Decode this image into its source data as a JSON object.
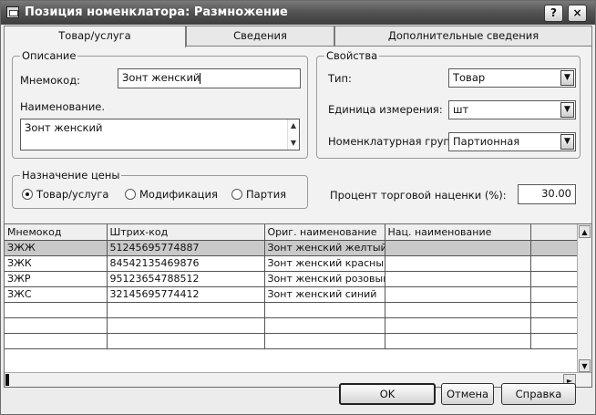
{
  "window": {
    "title": "Позиция номенклатора: Размножение"
  },
  "tabs": [
    "Товар/услуга",
    "Сведения",
    "Дополнительные сведения"
  ],
  "description": {
    "group_label": "Описание",
    "mnemocode_label": "Мнемокод:",
    "mnemocode_value": "Зонт женский",
    "name_label": "Наименование.",
    "name_value": "Зонт женский"
  },
  "price_purpose": {
    "group_label": "Назначение цены",
    "options": [
      "Товар/услуга",
      "Модификация",
      "Партия"
    ],
    "selected": "Товар/услуга"
  },
  "properties": {
    "group_label": "Свойства",
    "type_label": "Тип:",
    "type_value": "Товар",
    "unit_label": "Единица измерения:",
    "unit_value": "шт",
    "group_field_label": "Номенклатурная группа:",
    "group_field_value": "Партионная"
  },
  "markup": {
    "label": "Процент торговой наценки (%):",
    "value": "30.00"
  },
  "grid": {
    "columns": [
      "Мнемокод",
      "Штрих-код",
      "Ориг. наименование",
      "Нац. наименование"
    ],
    "rows": [
      [
        "ЗЖЖ",
        "5124569577488​7",
        "Зонт женский желтый",
        ""
      ],
      [
        "ЗЖК",
        "8454213546987​6",
        "Зонт женский красный",
        ""
      ],
      [
        "ЗЖР",
        "9512365478851​2",
        "Зонт женский розовый",
        ""
      ],
      [
        "ЗЖС",
        "3214569577441​2",
        "Зонт женский синий",
        ""
      ]
    ],
    "selected_row": 0
  },
  "buttons": {
    "ok": "OK",
    "cancel": "Отмена",
    "help": "Справка"
  },
  "titlebar_buttons": {
    "help": "?",
    "close": "×"
  }
}
